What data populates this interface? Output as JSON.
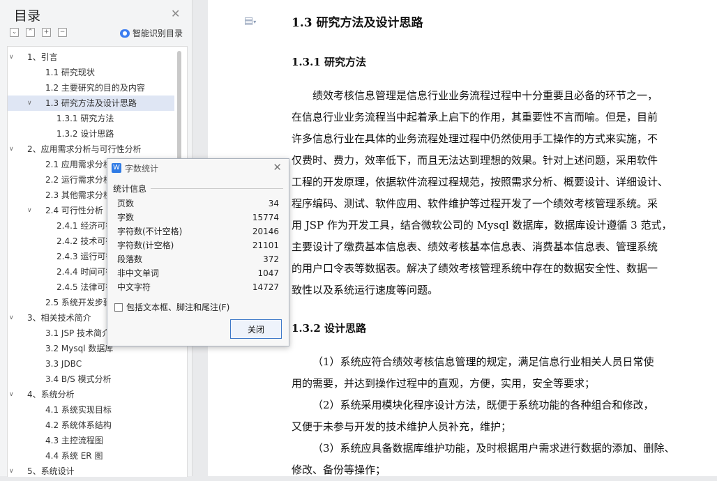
{
  "toc": {
    "title": "目录",
    "smart_label": "智能识别目录",
    "items": [
      {
        "label": "1、引言",
        "level": 0,
        "expanded": true
      },
      {
        "label": "1.1 研究现状",
        "level": 1
      },
      {
        "label": "1.2 主要研究的目的及内容",
        "level": 1
      },
      {
        "label": "1.3 研究方法及设计思路",
        "level": 1,
        "expanded": true,
        "selected": true
      },
      {
        "label": "1.3.1 研究方法",
        "level": 2
      },
      {
        "label": "1.3.2 设计思路",
        "level": 2
      },
      {
        "label": "2、应用需求分析与可行性分析",
        "level": 0,
        "expanded": true
      },
      {
        "label": "2.1 应用需求分析",
        "level": 1
      },
      {
        "label": "2.2 运行需求分析",
        "level": 1
      },
      {
        "label": "2.3 其他需求分析",
        "level": 1
      },
      {
        "label": "2.4 可行性分析",
        "level": 1,
        "expanded": true
      },
      {
        "label": "2.4.1 经济可行性",
        "level": 2
      },
      {
        "label": "2.4.2 技术可行性",
        "level": 2
      },
      {
        "label": "2.4.3 运行可行性",
        "level": 2
      },
      {
        "label": "2.4.4 时间可行性",
        "level": 2
      },
      {
        "label": "2.4.5 法律可行性",
        "level": 2
      },
      {
        "label": "2.5 系统开发步骤",
        "level": 1
      },
      {
        "label": "3、相关技术简介",
        "level": 0,
        "expanded": true
      },
      {
        "label": "3.1 JSP 技术简介",
        "level": 1
      },
      {
        "label": "3.2 Mysql 数据库",
        "level": 1
      },
      {
        "label": "3.3 JDBC",
        "level": 1
      },
      {
        "label": "3.4 B/S 模式分析",
        "level": 1
      },
      {
        "label": "4、系统分析",
        "level": 0,
        "expanded": true
      },
      {
        "label": "4.1 系统实现目标",
        "level": 1
      },
      {
        "label": "4.2 系统体系结构",
        "level": 1
      },
      {
        "label": "4.3 主控流程图",
        "level": 1
      },
      {
        "label": "4.4 系统 ER 图",
        "level": 1
      },
      {
        "label": "5、系统设计",
        "level": 0,
        "expanded": true
      }
    ]
  },
  "doc": {
    "heading": "1.3  研究方法及设计思路",
    "sub1": "1.3.1  研究方法",
    "para1": [
      "绩效考核信息管理是信息行业业务流程过程中十分重要且必备的环节之一，",
      "在信息行业业务流程当中起着承上启下的作用，其重要性不言而喻。但是，目前",
      "许多信息行业在具体的业务流程处理过程中仍然使用手工操作的方式来实施，不",
      "仅费时、费力，效率低下，而且无法达到理想的效果。针对上述问题，采用软件",
      "工程的开发原理，依据软件流程过程规范，按照需求分析、概要设计、详细设计、",
      "程序编码、测试、软件应用、软件维护等过程开发了一个绩效考核管理系统。采",
      "用 JSP 作为开发工具，结合微软公司的 Mysql 数据库，数据库设计遵循 3 范式，",
      "主要设计了缴费基本信息表、绩效考核基本信息表、消费基本信息表、管理系统",
      "的用户口令表等数据表。解决了绩效考核管理系统中存在的数据安全性、数据一",
      "致性以及系统运行速度等问题。"
    ],
    "sub2": "1.3.2  设计思路",
    "para2": [
      {
        "text": "（1）系统应符合绩效考核信息管理的规定，满足信息行业相关人员日常使",
        "indent": true
      },
      {
        "text": "用的需要，并达到操作过程中的直观，方便，实用，安全等要求；",
        "indent": false
      },
      {
        "text": "（2）系统采用模块化程序设计方法，既便于系统功能的各种组合和修改，",
        "indent": true
      },
      {
        "text": "又便于未参与开发的技术维护人员补充，维护；",
        "indent": false
      },
      {
        "text": "（3）系统应具备数据库维护功能，及时根据用户需求进行数据的添加、删除、",
        "indent": true
      },
      {
        "text": "修改、备份等操作；",
        "indent": false
      }
    ]
  },
  "wordcount": {
    "title": "字数统计",
    "group": "统计信息",
    "stats": [
      {
        "label": "页数",
        "value": "34"
      },
      {
        "label": "字数",
        "value": "15774"
      },
      {
        "label": "字符数(不计空格)",
        "value": "20146"
      },
      {
        "label": "字符数(计空格)",
        "value": "21101"
      },
      {
        "label": "段落数",
        "value": "372"
      },
      {
        "label": "非中文单词",
        "value": "1047"
      },
      {
        "label": "中文字符",
        "value": "14727"
      }
    ],
    "checkbox_label": "包括文本框、脚注和尾注(F)",
    "close_label": "关闭"
  }
}
